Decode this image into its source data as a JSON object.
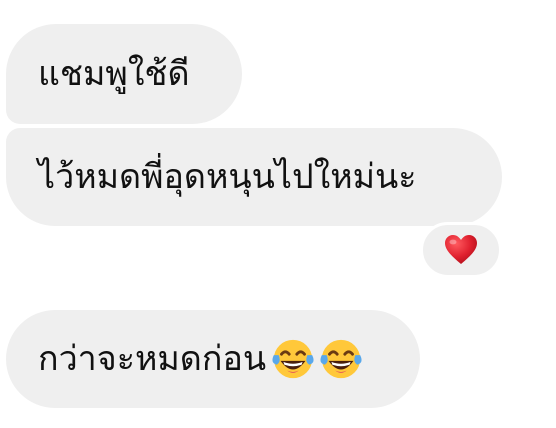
{
  "messages": [
    {
      "text": "แชมพูใช้ดี"
    },
    {
      "text": "ไว้หมดพี่อุดหนุนไปใหม่นะ",
      "reaction_icon": "red-heart-icon"
    },
    {
      "text": "กว่าจะหมดก่อน",
      "trailing_icons": [
        "face-with-tears-of-joy-icon",
        "face-with-tears-of-joy-icon"
      ]
    }
  ],
  "colors": {
    "bubble": "#efefef",
    "text": "#111111",
    "heart": "#e0212f",
    "emoji_face": "#ffc83a",
    "emoji_tears": "#5aa8ea"
  }
}
